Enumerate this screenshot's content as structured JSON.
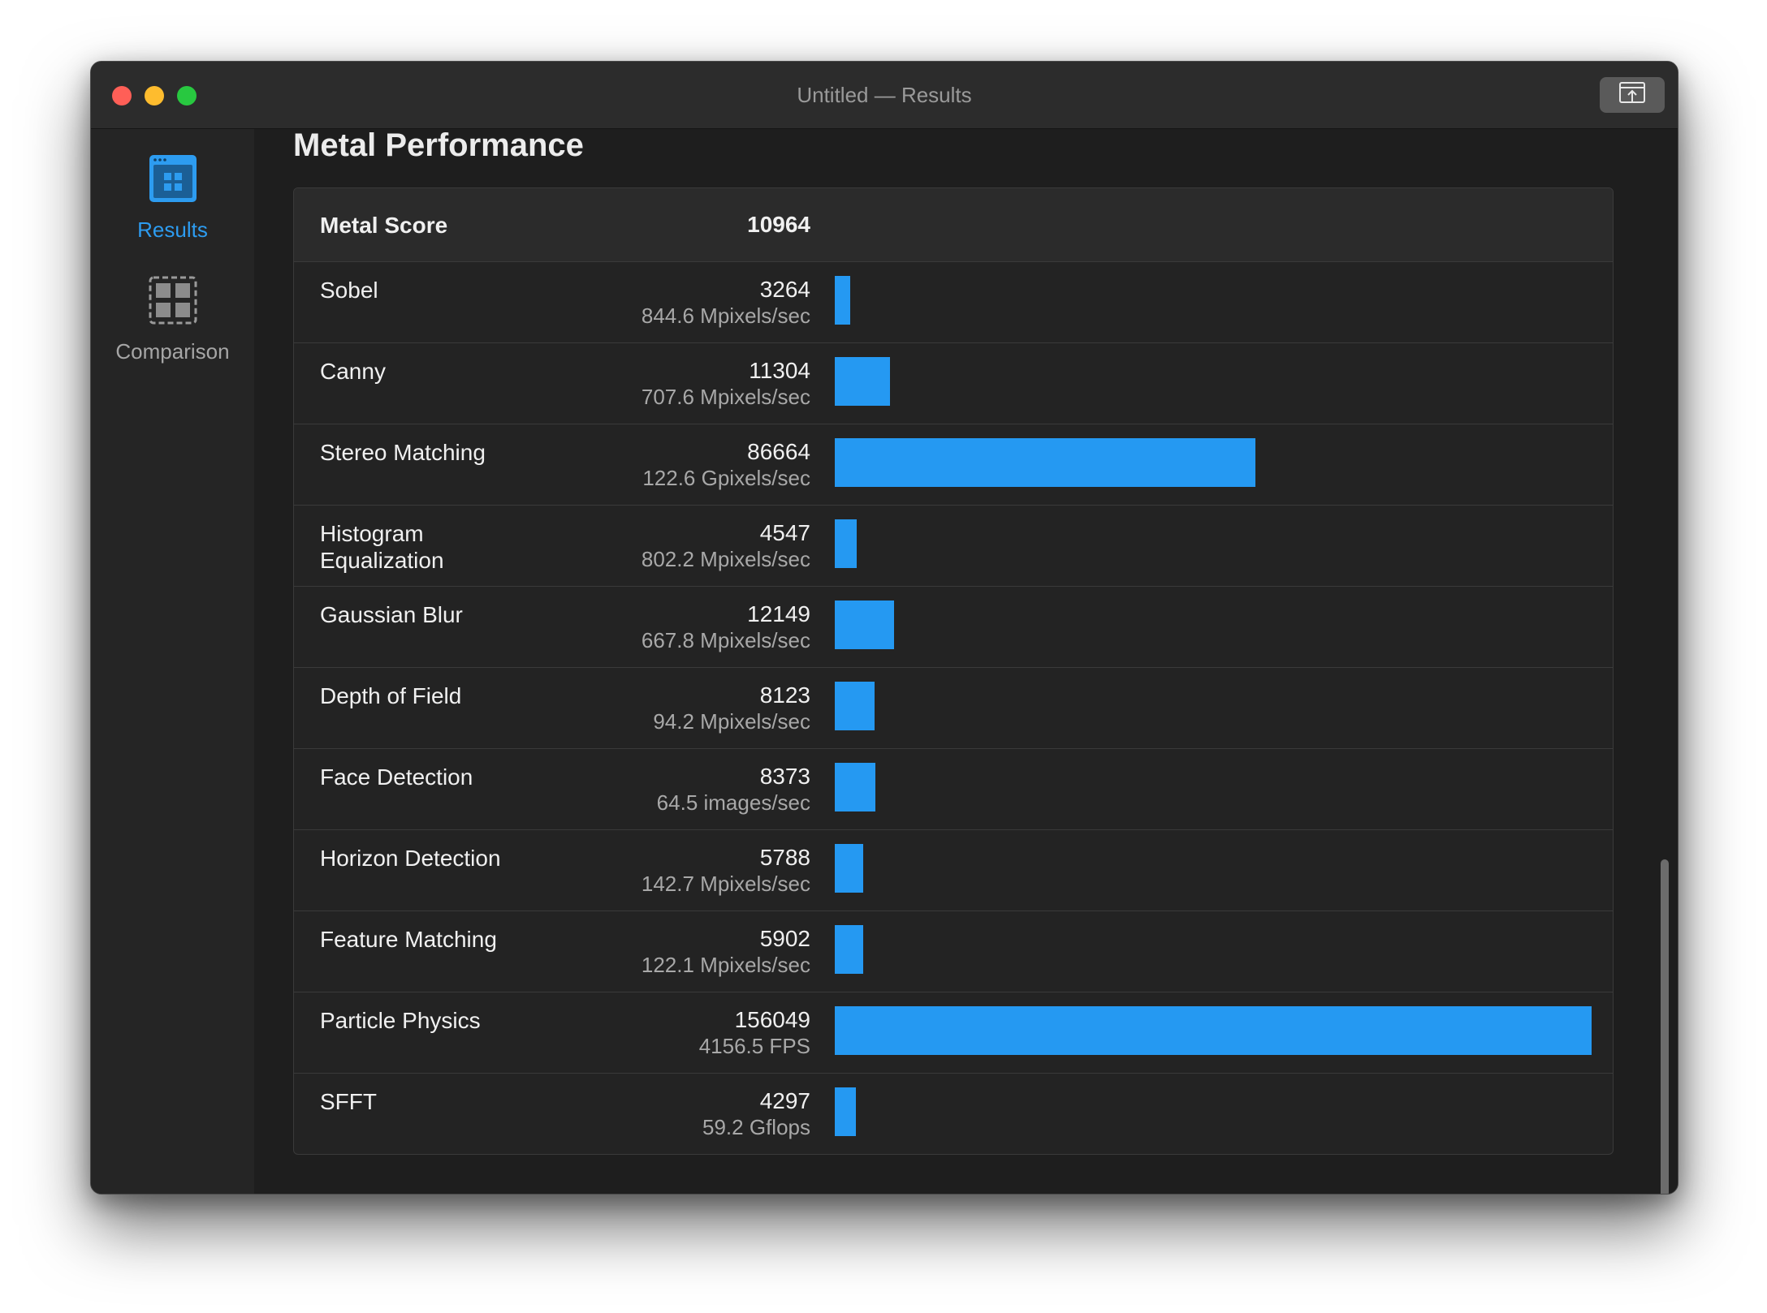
{
  "window": {
    "title": "Untitled — Results",
    "toolbar_button_icon": "share-upload-icon"
  },
  "colors": {
    "accent": "#2d9cf0",
    "bar": "#2599f2",
    "close": "#ff5f57",
    "minimize": "#febc2e",
    "zoom": "#28c840"
  },
  "sidebar": {
    "items": [
      {
        "label": "Results",
        "icon": "results-grid-icon",
        "selected": true
      },
      {
        "label": "Comparison",
        "icon": "comparison-grid-icon",
        "selected": false
      }
    ]
  },
  "main": {
    "title": "Metal Performance",
    "summary": {
      "name": "Metal Score",
      "score": "10964"
    },
    "max_score": 156049,
    "rows": [
      {
        "name": "Sobel",
        "score": "3264",
        "rate": "844.6 Mpixels/sec",
        "value": 3264
      },
      {
        "name": "Canny",
        "score": "11304",
        "rate": "707.6 Mpixels/sec",
        "value": 11304
      },
      {
        "name": "Stereo Matching",
        "score": "86664",
        "rate": "122.6 Gpixels/sec",
        "value": 86664
      },
      {
        "name": "Histogram Equalization",
        "score": "4547",
        "rate": "802.2 Mpixels/sec",
        "value": 4547
      },
      {
        "name": "Gaussian Blur",
        "score": "12149",
        "rate": "667.8 Mpixels/sec",
        "value": 12149
      },
      {
        "name": "Depth of Field",
        "score": "8123",
        "rate": "94.2 Mpixels/sec",
        "value": 8123
      },
      {
        "name": "Face Detection",
        "score": "8373",
        "rate": "64.5 images/sec",
        "value": 8373
      },
      {
        "name": "Horizon Detection",
        "score": "5788",
        "rate": "142.7 Mpixels/sec",
        "value": 5788
      },
      {
        "name": "Feature Matching",
        "score": "5902",
        "rate": "122.1 Mpixels/sec",
        "value": 5902
      },
      {
        "name": "Particle Physics",
        "score": "156049",
        "rate": "4156.5 FPS",
        "value": 156049
      },
      {
        "name": "SFFT",
        "score": "4297",
        "rate": "59.2 Gflops",
        "value": 4297
      }
    ]
  }
}
